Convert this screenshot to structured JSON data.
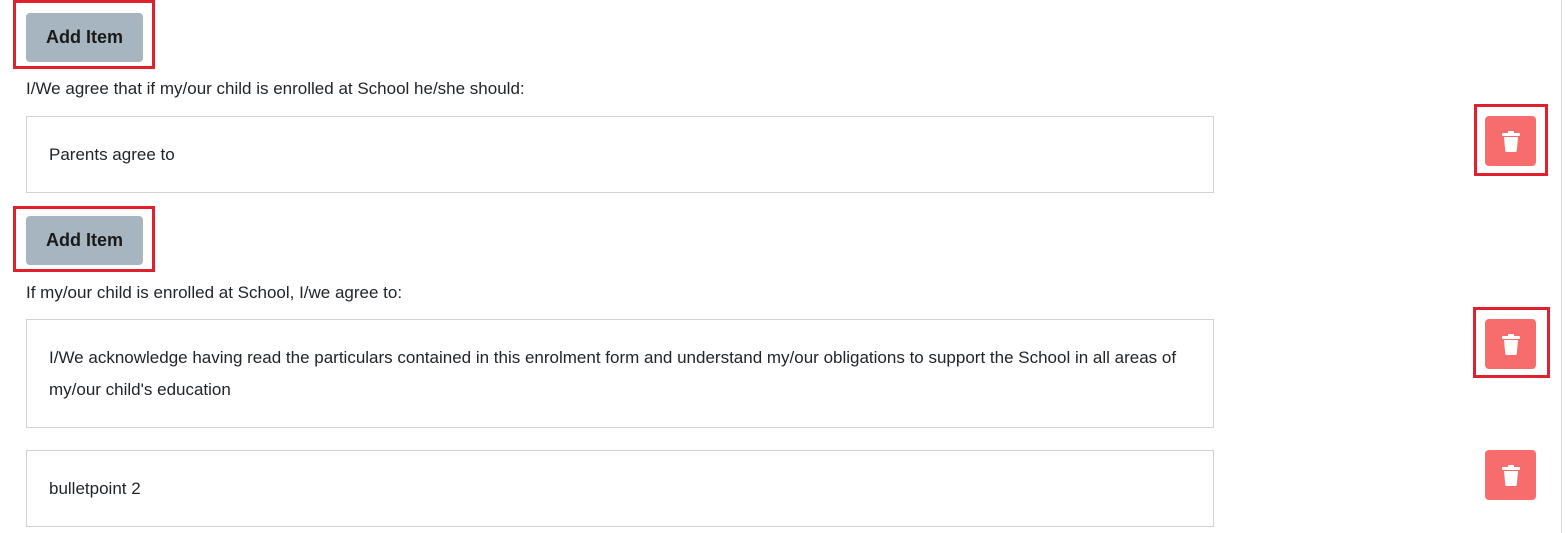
{
  "add_item_label": "Add Item",
  "sections": [
    {
      "label": "I/We agree that if my/our child is enrolled at School he/she should:",
      "items": [
        "Parents agree to"
      ]
    },
    {
      "label": "If my/our child is enrolled at School, I/we agree to:",
      "items": [
        "I/We acknowledge having read the particulars contained in this enrolment form and understand my/our obligations to support the School in all areas of my/our child's education",
        "bulletpoint 2"
      ]
    }
  ],
  "icons": {
    "delete": "trash-icon"
  },
  "colors": {
    "add_button_bg": "#a6b5bf",
    "delete_button_bg": "#f76c6c",
    "highlight_border": "#e0202e"
  }
}
